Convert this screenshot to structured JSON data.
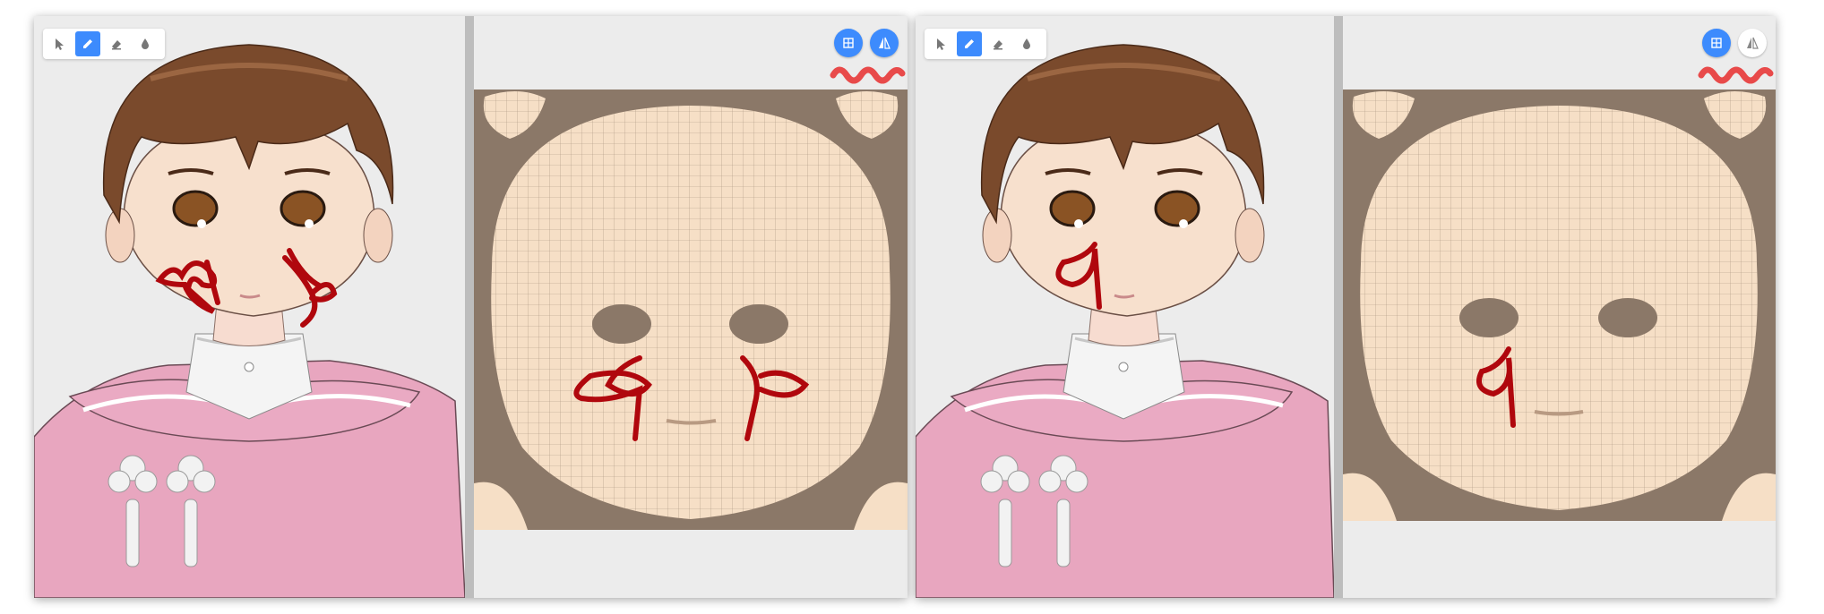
{
  "panels": [
    {
      "id": "before",
      "toolbar": {
        "tools": [
          {
            "icon": "cursor-icon",
            "active": false
          },
          {
            "icon": "pencil-icon",
            "active": true
          },
          {
            "icon": "eraser-icon",
            "active": false
          },
          {
            "icon": "drop-icon",
            "active": false
          }
        ]
      },
      "uv_toolbar": {
        "wireframe_toggle": {
          "icon": "grid-icon",
          "active": true
        },
        "mirror_toggle": {
          "icon": "mirror-icon",
          "active": true
        }
      },
      "annotation": "red-squiggle-highlight",
      "paint_strokes": "mirrored",
      "colors": {
        "paint": "#b0070d",
        "accent": "#3d8bfd",
        "uv_background": "#8b7868",
        "skin": "#f6dfc6"
      }
    },
    {
      "id": "after",
      "toolbar": {
        "tools": [
          {
            "icon": "cursor-icon",
            "active": false
          },
          {
            "icon": "pencil-icon",
            "active": true
          },
          {
            "icon": "eraser-icon",
            "active": false
          },
          {
            "icon": "drop-icon",
            "active": false
          }
        ]
      },
      "uv_toolbar": {
        "wireframe_toggle": {
          "icon": "grid-icon",
          "active": true
        },
        "mirror_toggle": {
          "icon": "mirror-icon",
          "active": false
        }
      },
      "annotation": "red-squiggle-highlight",
      "paint_strokes": "single",
      "colors": {
        "paint": "#b0070d",
        "accent": "#3d8bfd",
        "uv_background": "#8b7868",
        "skin": "#f6dfc6"
      }
    }
  ]
}
